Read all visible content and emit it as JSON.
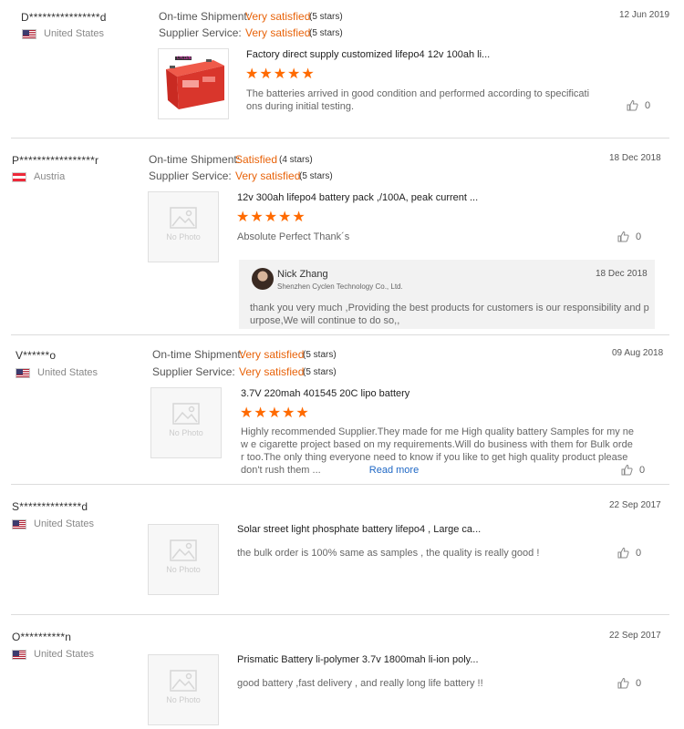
{
  "labels": {
    "ontime": "On-time Shipment:",
    "service": "Supplier Service:",
    "no_photo": "No Photo",
    "read_more": "Read more"
  },
  "reviews": [
    {
      "buyer": "D****************d",
      "country": "United States",
      "flag": "flag-us-icon",
      "ontime_rating": "Very satisfied",
      "ontime_stars": "(5 stars)",
      "service_rating": "Very satisfied",
      "service_stars": "(5 stars)",
      "date": "12 Jun 2019",
      "product_title": "Factory direct supply customized lifepo4 12v 100ah li...",
      "stars": "★★★★★",
      "feedback_line1": "The batteries arrived in good condition and performed according to specificati",
      "feedback_line2": "ons during initial testing.",
      "likes": "0",
      "has_photo": true
    },
    {
      "buyer": "P*****************r",
      "country": "Austria",
      "flag": "flag-at-icon",
      "ontime_rating": "Satisfied",
      "ontime_stars": "(4 stars)",
      "service_rating": "Very satisfied",
      "service_stars": "(5 stars)",
      "date": "18 Dec 2018",
      "product_title": "12v 300ah lifepo4 battery pack ,/100A, peak current ...",
      "stars": "★★★★★",
      "feedback": "Absolute Perfect Thank´s",
      "likes": "0",
      "reply": {
        "name": "Nick Zhang",
        "company": "Shenzhen Cyclen Technology Co., Ltd.",
        "date": "18 Dec 2018",
        "text_line1": "thank you very much ,Providing the best products for customers is our responsibility and p",
        "text_line2": "urpose,We will continue to do so,,"
      }
    },
    {
      "buyer": "V******o",
      "country": "United States",
      "flag": "flag-us-icon",
      "ontime_rating": "Very satisfied",
      "ontime_stars": "(5 stars)",
      "service_rating": "Very satisfied",
      "service_stars": "(5 stars)",
      "date": "09 Aug 2018",
      "product_title": "3.7V 220mah 401545 20C lipo battery",
      "stars": "★★★★★",
      "feedback_line1": "Highly recommended Supplier.They made for me High quality battery Samples for my ne",
      "feedback_line2": "w e cigarette project based on my requirements.Will do business with them for Bulk orde",
      "feedback_line3": "r too.The only thing everyone need to know if you like to get high quality product please",
      "feedback_line4": "don't rush them ...",
      "likes": "0"
    },
    {
      "buyer": "S**************d",
      "country": "United States",
      "flag": "flag-us-icon",
      "date": "22 Sep 2017",
      "product_title": "Solar street light phosphate battery lifepo4 , Large ca...",
      "feedback": "the bulk order is 100% same as samples , the quality is really good !",
      "likes": "0"
    },
    {
      "buyer": "O**********n",
      "country": "United States",
      "flag": "flag-us-icon",
      "date": "22 Sep 2017",
      "product_title": "Prismatic Battery li-polymer 3.7v 1800mah li-ion poly...",
      "feedback": "good battery ,fast delivery , and really long life battery !!",
      "likes": "0"
    }
  ],
  "colors": {
    "accent": "#e8630a",
    "star": "#ff6a00",
    "link": "#2068c5"
  }
}
